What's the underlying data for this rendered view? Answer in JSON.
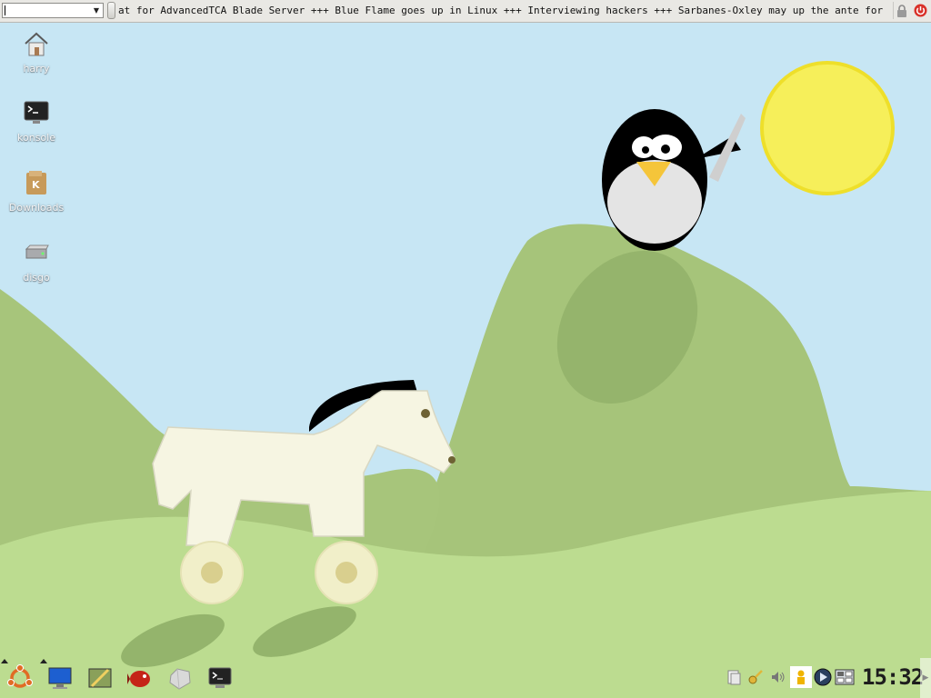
{
  "top_panel": {
    "command_input_value": "",
    "ticker_text": "at for AdvancedTCA Blade Server +++  Blue Flame goes up in Linux +++  Interviewing hackers +++  Sarbanes-Oxley may up the ante for GPL violatio",
    "lock_icon": "lock-icon",
    "logout_icon": "power-icon"
  },
  "desktop": {
    "icons": [
      {
        "label": "harry",
        "icon": "home-folder-icon"
      },
      {
        "label": "konsole",
        "icon": "terminal-icon"
      },
      {
        "label": "Downloads",
        "icon": "downloads-folder-icon"
      },
      {
        "label": "disgo",
        "icon": "hard-drive-icon"
      }
    ]
  },
  "bottom_panel": {
    "launchers": [
      "ubuntu-menu-icon",
      "desktop-monitor-icon",
      "text-editor-icon",
      "fish-icon",
      "gem-icon",
      "terminal-icon"
    ],
    "tray": [
      "clipboard-icon",
      "keyring-icon",
      "volume-icon",
      "network-user-icon",
      "media-player-icon",
      "desktop-switch-icon"
    ],
    "clock": "15:32"
  },
  "colors": {
    "sky": "#c7e6f4",
    "hill_back": "#a6c47a",
    "hill_front": "#bcdc90",
    "sun": "#f6ef5a"
  }
}
